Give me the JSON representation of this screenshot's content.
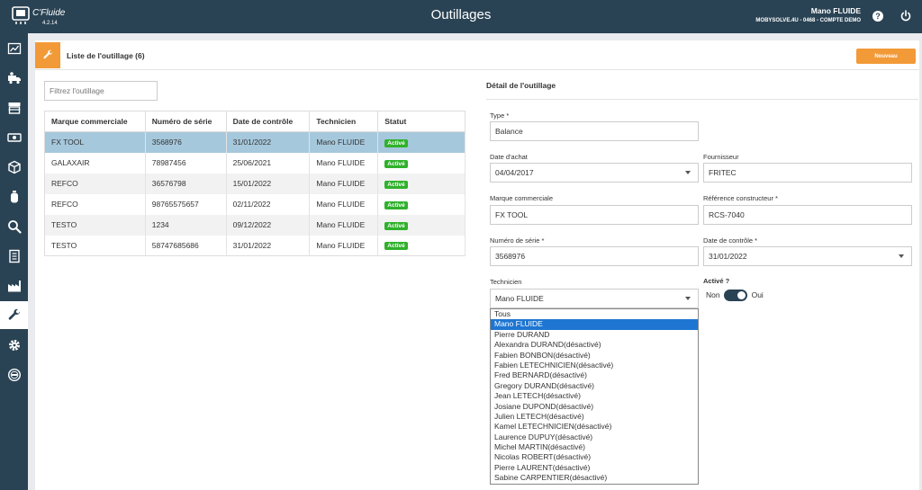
{
  "app": {
    "logo_name": "C'Fluide",
    "version": "4.2.14",
    "title": "Outillages",
    "user_name": "Mano FLUIDE",
    "company": "MOBYSOLVE.4U - 0468 - COMPTE DEMO",
    "help_glyph": "?"
  },
  "sidebar": {
    "icons": [
      "dashboard-icon",
      "truck-icon",
      "store-icon",
      "money-icon",
      "box-icon",
      "gas-cylinder-icon",
      "search-icon",
      "document-icon",
      "factory-icon",
      "wrench-icon",
      "gear-icon",
      "badge-icon"
    ],
    "active": "wrench-icon"
  },
  "panel": {
    "title": "Liste de l'outillage (6)",
    "new_button": "Nouveau",
    "filter_placeholder": "Filtrez l'outillage"
  },
  "table": {
    "headers": [
      "Marque commerciale",
      "Numéro de série",
      "Date de contrôle",
      "Technicien",
      "Statut"
    ],
    "rows": [
      [
        "FX TOOL",
        "3568976",
        "31/01/2022",
        "Mano FLUIDE",
        "Activé"
      ],
      [
        "GALAXAIR",
        "78987456",
        "25/06/2021",
        "Mano FLUIDE",
        "Activé"
      ],
      [
        "REFCO",
        "36576798",
        "15/01/2022",
        "Mano FLUIDE",
        "Activé"
      ],
      [
        "REFCO",
        "98765575657",
        "02/11/2022",
        "Mano FLUIDE",
        "Activé"
      ],
      [
        "TESTO",
        "1234",
        "09/12/2022",
        "Mano FLUIDE",
        "Activé"
      ],
      [
        "TESTO",
        "58747685686",
        "31/01/2022",
        "Mano FLUIDE",
        "Activé"
      ]
    ],
    "selected_row": 0
  },
  "detail": {
    "title": "Détail de l'outillage",
    "type_label": "Type *",
    "type_value": "Balance",
    "purchase_date_label": "Date d'achat",
    "purchase_date_value": "04/04/2017",
    "supplier_label": "Fournisseur",
    "supplier_value": "FRITEC",
    "brand_label": "Marque commerciale",
    "brand_value": "FX TOOL",
    "manufacturer_ref_label": "Référence constructeur *",
    "manufacturer_ref_value": "RCS-7040",
    "serial_label": "Numéro de série *",
    "serial_value": "3568976",
    "control_date_label": "Date de contrôle *",
    "control_date_value": "31/01/2022",
    "technician_label": "Technicien",
    "technician_value": "Mano FLUIDE",
    "active_label": "Activé ?",
    "active_off": "Non",
    "active_on": "Oui",
    "active_value": true
  },
  "technician_dropdown": {
    "options": [
      "Tous",
      "Mano FLUIDE",
      "Pierre DURAND",
      "Alexandra DURAND(désactivé)",
      "Fabien BONBON(désactivé)",
      "Fabien LETECHNICIEN(désactivé)",
      "Fred BERNARD(désactivé)",
      "Gregory DURAND(désactivé)",
      "Jean LETECH(désactivé)",
      "Josiane DUPOND(désactivé)",
      "Julien LETECH(désactivé)",
      "Kamel LETECHNICIEN(désactivé)",
      "Laurence DUPUY(désactivé)",
      "Michel MARTIN(désactivé)",
      "Nicolas ROBERT(désactivé)",
      "Pierre LAURENT(désactivé)",
      "Sabine CARPENTIER(désactivé)"
    ],
    "highlighted": 1
  },
  "colors": {
    "header_bg": "#2a4354",
    "accent_orange": "#f29a38",
    "selected_row": "#a6c8dc",
    "status_green": "#2fb12b",
    "dropdown_highlight": "#1e76d2"
  }
}
